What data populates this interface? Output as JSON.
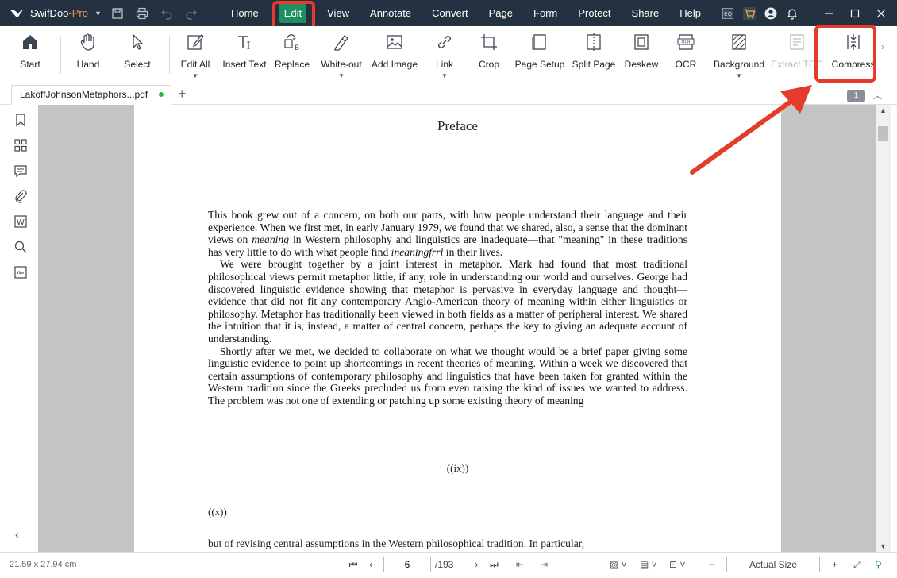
{
  "app": {
    "name": "SwifDoo",
    "edition": "-Pro"
  },
  "menu": [
    {
      "label": "Home",
      "active": false
    },
    {
      "label": "Edit",
      "active": true
    },
    {
      "label": "View",
      "active": false
    },
    {
      "label": "Annotate",
      "active": false
    },
    {
      "label": "Convert",
      "active": false
    },
    {
      "label": "Page",
      "active": false
    },
    {
      "label": "Form",
      "active": false
    },
    {
      "label": "Protect",
      "active": false
    },
    {
      "label": "Share",
      "active": false
    },
    {
      "label": "Help",
      "active": false
    }
  ],
  "ribbon": {
    "start": "Start",
    "hand": "Hand",
    "select": "Select",
    "edit_all": "Edit All",
    "insert_text": "Insert Text",
    "replace": "Replace",
    "white_out": "White-out",
    "add_image": "Add Image",
    "link": "Link",
    "crop": "Crop",
    "page_setup": "Page Setup",
    "split_page": "Split Page",
    "deskew": "Deskew",
    "ocr": "OCR",
    "background": "Background",
    "extract_toc": "Extract TOC",
    "compress": "Compress"
  },
  "tabs": {
    "doc_name": "LakoffJohnsonMetaphors...pdf",
    "add": "+",
    "page_badge": "1"
  },
  "document": {
    "title": "Preface",
    "paragraphs": [
      {
        "indent": false,
        "text": "This book grew out of a concern, on both our parts, with how people understand their language and their experience. When we first met, in early January 1979, we found that we shared, also, a sense that the dominant views on meaning in Western philosophy and linguistics are inadequate—that \"meaning\" in these traditions has very little to do with what people find ineaningfrrl in their lives."
      },
      {
        "indent": true,
        "text": "We were brought together by a joint interest in metaphor. Mark had found that most traditional philosophical views permit metaphor little, if any, role in understanding our world and ourselves. George had discovered linguistic evidence showing that metaphor is pervasive in everyday language and thought—evidence that did not fit any contemporary Anglo-American theory of meaning within either linguistics or philosophy. Metaphor has traditionally been viewed in both fields as a matter of peripheral interest. We shared the intuition that it is, instead, a matter of central concern, perhaps the key to giving an adequate account of understanding."
      },
      {
        "indent": true,
        "text": "Shortly after we met, we decided to collaborate on what we thought would be a brief paper giving some linguistic evidence to point up shortcomings in recent theories of meaning. Within a week we discovered that certain assumptions of contemporary philosophy and linguistics that have been taken for granted within the Western tradition since the Greeks precluded us from even raising the kind of issues we wanted to address. The problem was not one of extending or patching up some existing theory of meaning"
      }
    ],
    "page_number_1": "((ix))",
    "page_number_2": "((x))",
    "continuation": "but of revising central assumptions in the Western philosophical tradition. In particular,"
  },
  "status": {
    "dimensions": "21.59 x 27.94 cm",
    "current_page": "6",
    "total_pages": "/193",
    "zoom": "Actual Size"
  },
  "colors": {
    "titlebar": "#243140",
    "active_tab": "#1f8f5f",
    "highlight": "#e53b2b",
    "brand_accent": "#f39c33"
  }
}
